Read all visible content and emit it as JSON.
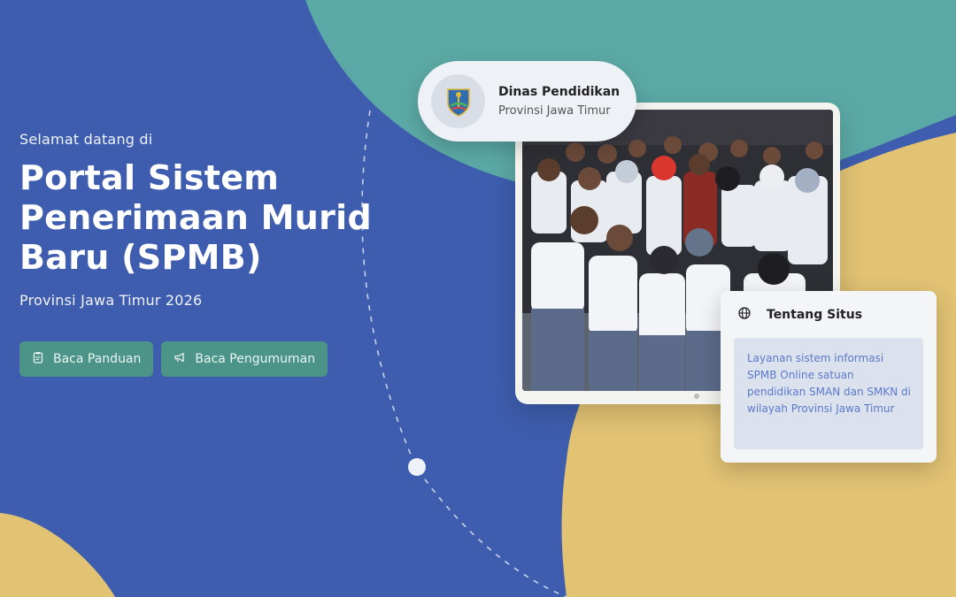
{
  "hero": {
    "welcome": "Selamat datang di",
    "title": "Portal Sistem Penerimaan Murid Baru (SPMB)",
    "subtitle": "Provinsi Jawa Timur 2026"
  },
  "actions": [
    {
      "label": "Baca Panduan",
      "icon": "clipboard-icon"
    },
    {
      "label": "Baca Pengumuman",
      "icon": "megaphone-icon"
    }
  ],
  "dinas": {
    "title": "Dinas Pendidikan",
    "subtitle": "Provinsi Jawa Timur",
    "icon": "province-emblem-icon"
  },
  "about": {
    "title": "Tentang Situs",
    "icon": "globe-icon",
    "text": "Layanan sistem informasi SPMB Online satuan pendidikan SMAN dan SMKN di wilayah Provinsi Jawa Timur"
  },
  "colors": {
    "background_blue": "#3e5dae",
    "teal": "#5ba9a6",
    "gold": "#e2c374",
    "button": "#4b9487",
    "about_text": "#5b79c9"
  }
}
